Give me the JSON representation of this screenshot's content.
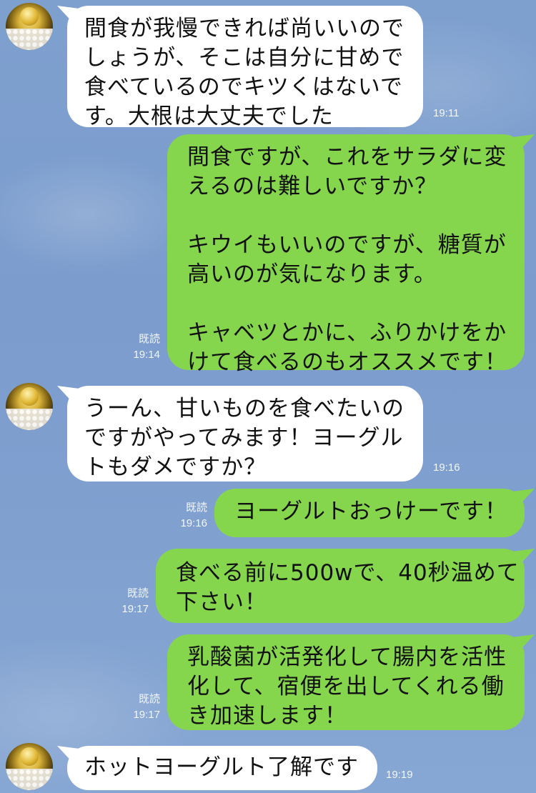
{
  "chat": {
    "messages": [
      {
        "side": "in",
        "text": "間食が我慢できれば尚いいので\nしょうが、そこは自分に甘めで\n食べているのでキツくはないで\nす。大根は大丈夫でした",
        "time": "19:11"
      },
      {
        "side": "out",
        "text": "間食ですが、これをサラダに変\nえるのは難しいですか？\n\nキウイもいいのですが、糖質が\n高いのが気になります。\n\nキャベツとかに、ふりかけをか\nけて食べるのもオススメです！",
        "read": "既読",
        "time": "19:14"
      },
      {
        "side": "in",
        "text": "うーん、甘いものを食べたいの\nですがやってみます！ヨーグル\nトもダメですか？",
        "time": "19:16"
      },
      {
        "side": "out",
        "text": "ヨーグルトおっけーです！",
        "read": "既読",
        "time": "19:16"
      },
      {
        "side": "out",
        "text": "食べる前に500wで、40秒温めて\n下さい！",
        "read": "既読",
        "time": "19:17"
      },
      {
        "side": "out",
        "text": "乳酸菌が活発化して腸内を活性\n化して、宿便を出してくれる働\nき加速します！",
        "read": "既読",
        "time": "19:17"
      },
      {
        "side": "in",
        "text": "ホットヨーグルト了解です",
        "time": "19:19"
      }
    ]
  }
}
